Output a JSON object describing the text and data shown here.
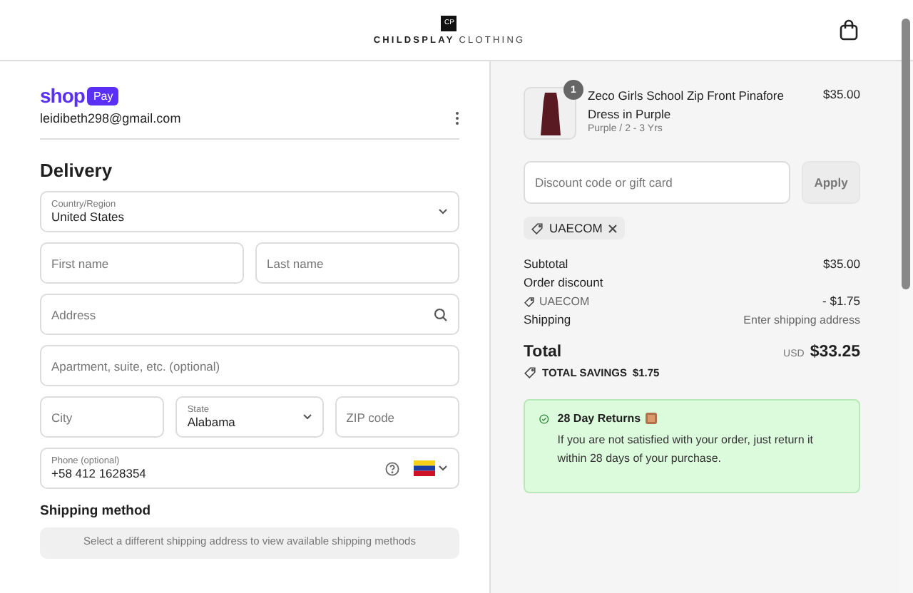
{
  "header": {
    "logo_mark": "CP",
    "brand": "CHILDSPLAY",
    "brand_suffix": "CLOTHING"
  },
  "account": {
    "wallet": "shop",
    "wallet_badge": "Pay",
    "email": "leidibeth298@gmail.com"
  },
  "delivery": {
    "title": "Delivery",
    "field_rows": [
      [
        {
          "kind": "select",
          "label": "Country/Region",
          "value": "United States"
        }
      ],
      [
        {
          "kind": "text",
          "placeholder": "First name"
        },
        {
          "kind": "text",
          "placeholder": "Last name"
        }
      ],
      [
        {
          "kind": "search",
          "placeholder": "Address"
        }
      ],
      [
        {
          "kind": "text",
          "placeholder": "Apartment, suite, etc. (optional)"
        }
      ],
      [
        {
          "kind": "text",
          "placeholder": "City"
        },
        {
          "kind": "select",
          "label": "State",
          "value": "Alabama"
        },
        {
          "kind": "text",
          "placeholder": "ZIP code"
        }
      ],
      [
        {
          "kind": "phone",
          "label": "Phone (optional)",
          "value": "+58 412 1628354"
        }
      ]
    ]
  },
  "shipping_method": {
    "title": "Shipping method",
    "notice": "Select a different shipping address to view available shipping methods"
  },
  "order": {
    "item": {
      "quantity": "1",
      "name": "Zeco Girls School Zip Front Pinafore Dress in Purple",
      "variant": "Purple / 2 - 3 Yrs",
      "price": "$35.00"
    },
    "discount": {
      "placeholder": "Discount code or gift card",
      "button": "Apply",
      "applied_code": "UAECOM"
    },
    "summary": [
      {
        "label": "Subtotal",
        "value": "$35.00"
      },
      {
        "label": "Order discount",
        "code": "UAECOM",
        "value": "- $1.75"
      },
      {
        "label": "Shipping",
        "value": "Enter shipping address"
      }
    ],
    "total": {
      "label": "Total",
      "currency": "USD",
      "amount": "$33.25"
    },
    "savings": {
      "label": "TOTAL SAVINGS",
      "amount": "$1.75"
    },
    "returns": {
      "title": "28 Day Returns",
      "text": "If you are not satisfied with your order, just return it within 28 days of your purchase."
    }
  }
}
